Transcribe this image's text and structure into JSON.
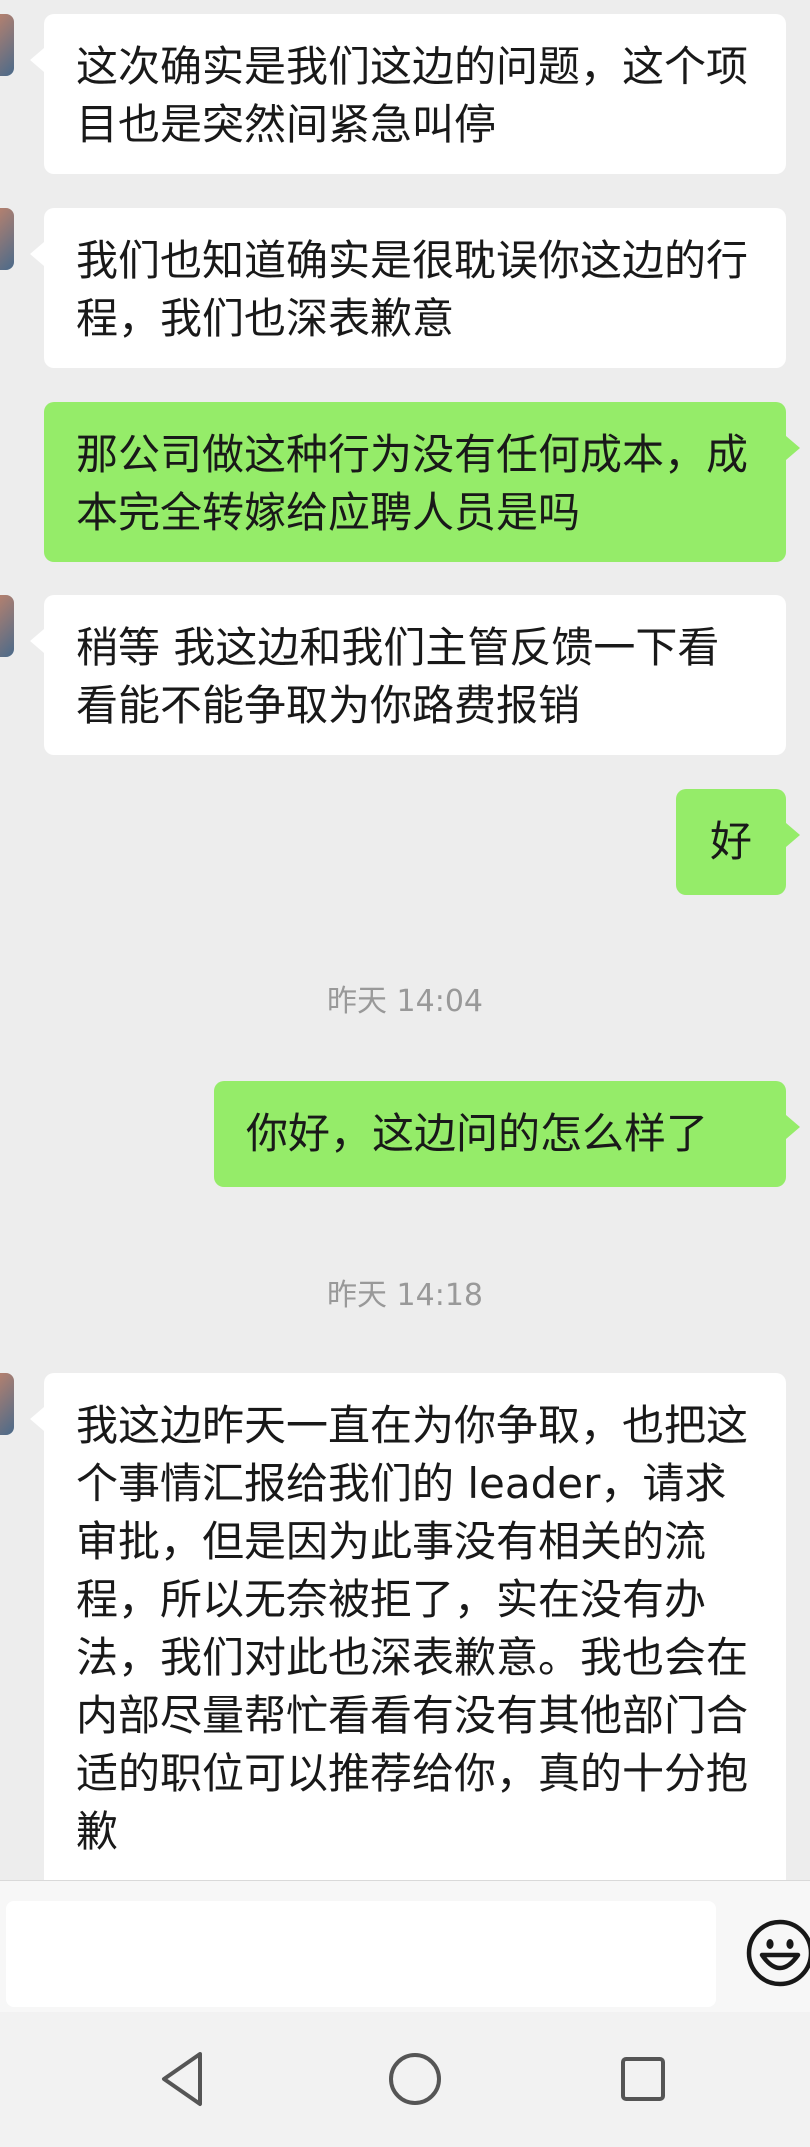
{
  "messages": [
    {
      "side": "in",
      "text": "这次确实是我们这边的问题，这个项目也是突然间紧急叫停"
    },
    {
      "side": "in",
      "text": "我们也知道确实是很耽误你这边的行程，我们也深表歉意"
    },
    {
      "side": "out",
      "text": "那公司做这种行为没有任何成本，成本完全转嫁给应聘人员是吗"
    },
    {
      "side": "in",
      "text": "稍等 我这边和我们主管反馈一下看看能不能争取为你路费报销"
    },
    {
      "side": "out",
      "text": "好"
    },
    {
      "side": "out",
      "text": "你好，这边问的怎么样了"
    },
    {
      "side": "in",
      "text": "我这边昨天一直在为你争取，也把这个事情汇报给我们的 leader，请求审批，但是因为此事没有相关的流程，所以无奈被拒了，实在没有办法，我们对此也深表歉意。我也会在内部尽量帮忙看看有没有其他部门合适的职位可以推荐给你，真的十分抱歉"
    }
  ],
  "timestamps": [
    "昨天 14:04",
    "昨天 14:18"
  ],
  "input": {
    "value": "",
    "placeholder": ""
  },
  "icons": {
    "emoji": "smiley-face-icon",
    "nav_back": "back-triangle-icon",
    "nav_home": "home-circle-icon",
    "nav_recent": "recent-apps-square-icon"
  },
  "colors": {
    "background": "#ededed",
    "incoming_bubble": "#ffffff",
    "outgoing_bubble": "#95ec69",
    "timestamp_text": "#999999"
  }
}
